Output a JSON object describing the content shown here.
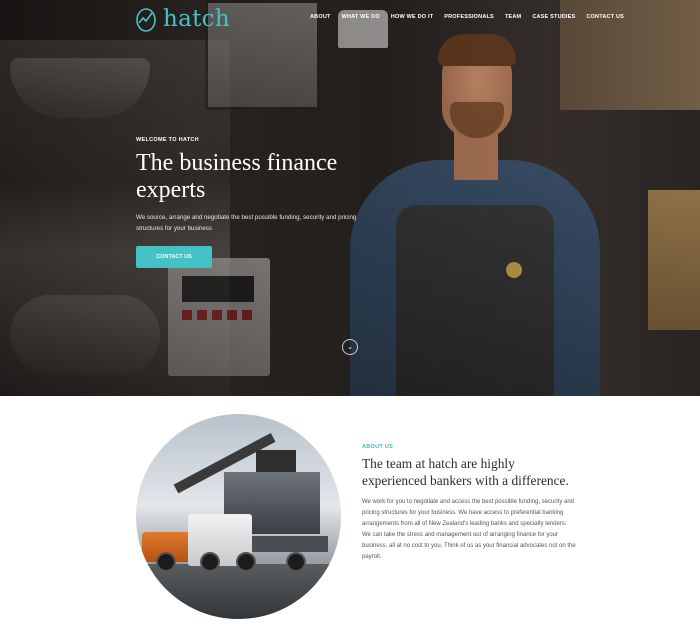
{
  "brand": {
    "name": "hatch",
    "accent": "#45c2c6"
  },
  "nav": {
    "items": [
      "ABOUT",
      "WHAT WE DO",
      "HOW WE DO IT",
      "PROFESSIONALS",
      "TEAM",
      "CASE STUDIES",
      "CONTACT US"
    ]
  },
  "hero": {
    "eyebrow": "WELCOME TO HATCH",
    "headline_line1": "The business finance",
    "headline_line2": "experts",
    "subtext": "We source, arrange and negotiate the best possible funding, security and pricing structures for your business",
    "cta_label": "CONTACT US",
    "scroll_icon": "chevron-down-icon"
  },
  "about": {
    "eyebrow": "ABOUT US",
    "heading": "The team at hatch are highly experienced bankers with a difference.",
    "body": "We work for you to negotiate and access the best possible funding, security and pricing structures for your business. We have access to preferential banking arrangements from all of New Zealand's leading banks and specialty lenders. We can take the stress and management out of arranging finance for your business, all at no cost to you. Think of us as your financial advocates not on the payroll."
  }
}
